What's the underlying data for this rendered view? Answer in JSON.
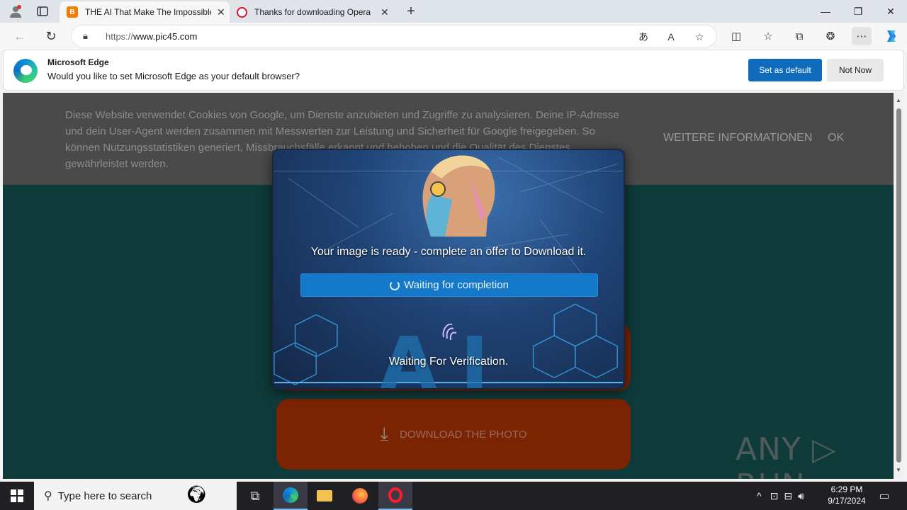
{
  "tabs": [
    {
      "title": "THE AI That Make The Impossible",
      "favicon": "blogger-icon",
      "active": true
    },
    {
      "title": "Thanks for downloading Opera",
      "favicon": "opera-icon",
      "active": false
    }
  ],
  "addressbar": {
    "scheme": "https://",
    "host": "www.pic45.com"
  },
  "infobar": {
    "title": "Microsoft Edge",
    "message": "Would you like to set Microsoft Edge as your default browser?",
    "set_default": "Set as default",
    "not_now": "Not Now"
  },
  "cookie": {
    "text": "Diese Website verwendet Cookies von Google, um Dienste anzubieten und Zugriffe zu analysieren. Deine IP-Adresse und dein User-Agent werden zusammen mit Messwerten zur Leistung und Sicherheit für Google freigegeben. So können Nutzungsstatistiken generiert, Missbrauchsfälle erkannt und behoben und die Qualität des Dienstes gewährleistet werden.",
    "more_info": "WEITERE INFORMATIONEN",
    "ok": "OK"
  },
  "modal": {
    "message": "Your image is ready - complete an offer to Download it.",
    "button": "Waiting for completion",
    "verification": "Waiting For Verification.",
    "background_letters": "AI"
  },
  "page": {
    "download_button": "DOWNLOAD THE PHOTO"
  },
  "watermark": "ANY ▷ RUN",
  "taskbar": {
    "search_placeholder": "Type here to search",
    "time": "6:29 PM",
    "date": "9/17/2024"
  },
  "colors": {
    "accent": "#0f6cbd",
    "modal_button": "#1479c9",
    "download_button": "#7b2404",
    "page_bg": "#0e3b3a"
  }
}
